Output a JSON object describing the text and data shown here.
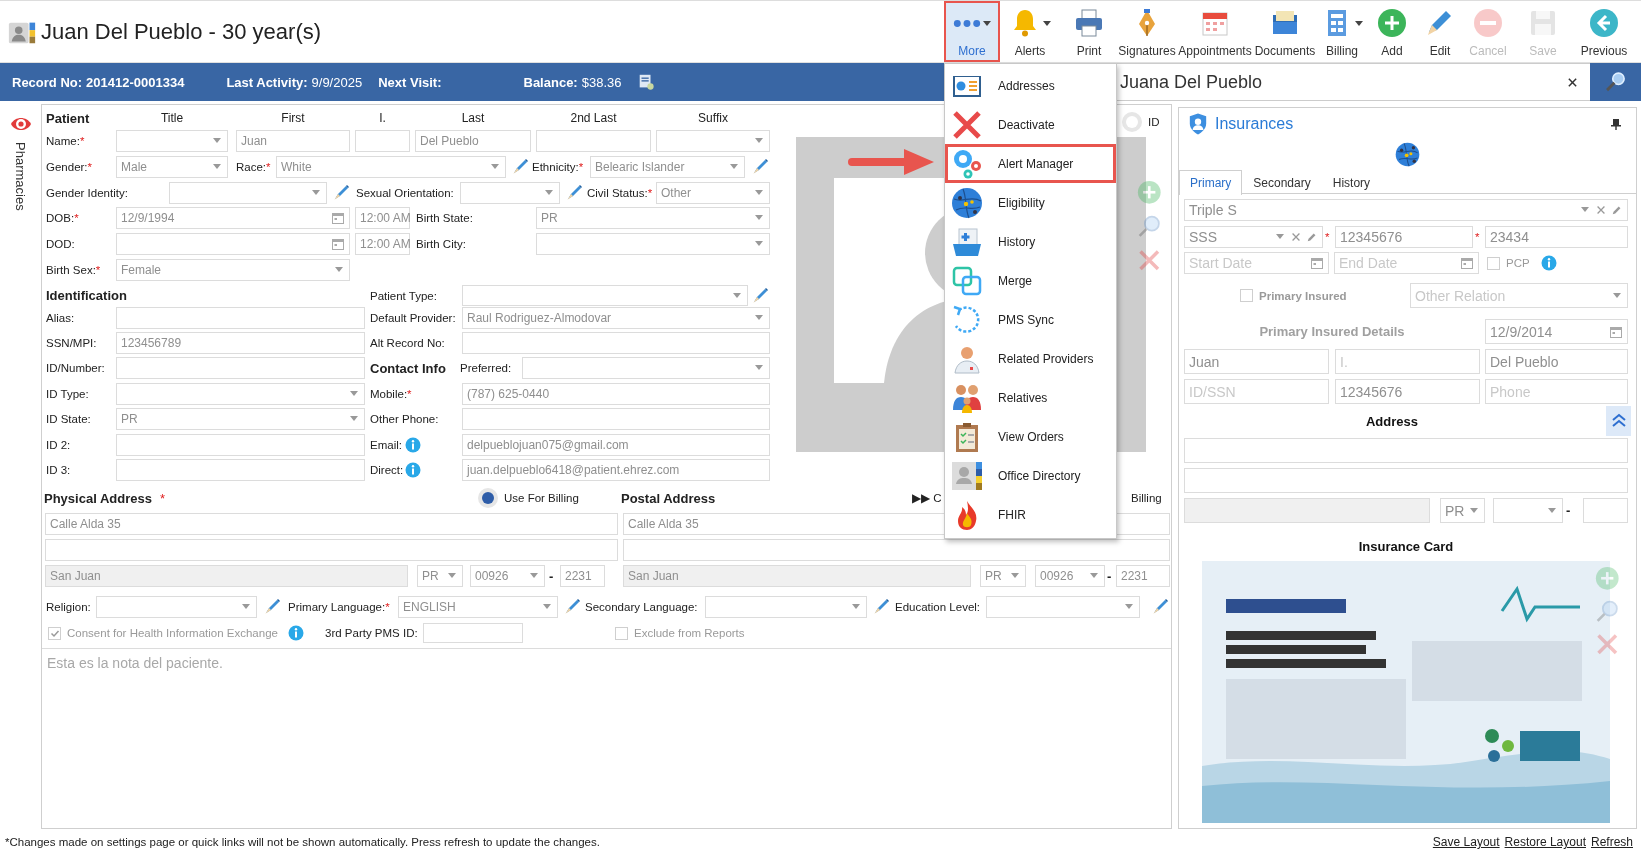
{
  "header": {
    "title": "Juan Del Pueblo - 30 year(s)"
  },
  "toolbar": [
    {
      "kind": "more",
      "label": "More",
      "dropdown": true,
      "disabled": false,
      "annotated": true
    },
    {
      "kind": "alerts",
      "label": "Alerts",
      "dropdown": true,
      "disabled": false,
      "annotated": false
    },
    {
      "kind": "print",
      "label": "Print",
      "dropdown": false,
      "disabled": false,
      "annotated": false
    },
    {
      "kind": "signatures",
      "label": "Signatures",
      "dropdown": false,
      "disabled": false,
      "annotated": false
    },
    {
      "kind": "appointments",
      "label": "Appointments",
      "dropdown": false,
      "disabled": false,
      "annotated": false
    },
    {
      "kind": "documents",
      "label": "Documents",
      "dropdown": false,
      "disabled": false,
      "annotated": false
    },
    {
      "kind": "billing",
      "label": "Billing",
      "dropdown": true,
      "disabled": false,
      "annotated": false
    },
    {
      "kind": "add",
      "label": "Add",
      "dropdown": false,
      "disabled": false,
      "annotated": false
    },
    {
      "kind": "edit",
      "label": "Edit",
      "dropdown": false,
      "disabled": false,
      "annotated": false
    },
    {
      "kind": "cancel",
      "label": "Cancel",
      "dropdown": false,
      "disabled": true,
      "annotated": false
    },
    {
      "kind": "save",
      "label": "Save",
      "dropdown": false,
      "disabled": true,
      "annotated": false
    },
    {
      "kind": "previous",
      "label": "Previous",
      "dropdown": false,
      "disabled": false,
      "annotated": false
    }
  ],
  "info_bar": {
    "items": [
      {
        "label": "Record No:",
        "value": "201412-0001334",
        "strong": true
      },
      {
        "label": "Last Activity:",
        "value": "9/9/2025",
        "strong": false
      },
      {
        "label": "Next Visit:"
      },
      {
        "label": "Balance:",
        "value": "$38.36",
        "strong": false
      }
    ]
  },
  "search": {
    "value": "Juana Del Pueblo"
  },
  "side_tab": {
    "label": "Pharmacies"
  },
  "patient_form": {
    "rows": [
      {
        "items": [
          {
            "kind": "heading",
            "text": "Patient"
          },
          {
            "kind": "caption",
            "text": "Title"
          },
          {
            "kind": "caption",
            "text": "First"
          },
          {
            "kind": "caption",
            "text": "I."
          },
          {
            "kind": "caption",
            "text": "Last"
          },
          {
            "kind": "caption",
            "text": "2nd Last"
          },
          {
            "kind": "caption",
            "text": "Suffix"
          }
        ]
      },
      {
        "items": [
          {
            "kind": "label",
            "text": "Name:",
            "mark": "*"
          },
          {
            "kind": "dropdown"
          },
          {
            "kind": "text",
            "value": "Juan"
          },
          {
            "kind": "text"
          },
          {
            "kind": "text",
            "value": "Del Pueblo"
          },
          {
            "kind": "text"
          },
          {
            "kind": "dropdown"
          }
        ]
      },
      {
        "items": [
          {
            "kind": "label",
            "text": "Gender:",
            "mark": "*"
          },
          {
            "kind": "dropdown",
            "value": "Male"
          },
          {
            "kind": "label",
            "text": "Race:",
            "mark": "*"
          },
          {
            "kind": "dropdown",
            "value": "White"
          },
          {
            "kind": "edit"
          },
          {
            "kind": "label",
            "text": "Ethnicity:",
            "mark": "*"
          },
          {
            "kind": "dropdown",
            "value": "Belearic Islander"
          },
          {
            "kind": "edit"
          }
        ]
      },
      {
        "items": [
          {
            "kind": "label",
            "text": "Gender Identity:"
          },
          {
            "kind": "dropdown"
          },
          {
            "kind": "edit"
          },
          {
            "kind": "label",
            "text": "Sexual Orientation:"
          },
          {
            "kind": "dropdown"
          },
          {
            "kind": "edit"
          },
          {
            "kind": "label",
            "text": "Civil Status:",
            "mark": "*"
          },
          {
            "kind": "dropdown",
            "value": "Other"
          }
        ]
      },
      {
        "items": [
          {
            "kind": "label",
            "text": "DOB:",
            "mark": "*"
          },
          {
            "kind": "date",
            "value": "12/9/1994"
          },
          {
            "kind": "time",
            "value": "12:00 AM"
          },
          {
            "kind": "label",
            "text": "Birth State:"
          },
          {
            "kind": "dropdown",
            "value": "PR"
          }
        ]
      },
      {
        "items": [
          {
            "kind": "label",
            "text": "DOD:"
          },
          {
            "kind": "date"
          },
          {
            "kind": "time",
            "value": "12:00 AM"
          },
          {
            "kind": "label",
            "text": "Birth City:"
          },
          {
            "kind": "dropdown"
          }
        ]
      },
      {
        "items": [
          {
            "kind": "label",
            "text": "Birth Sex:",
            "mark": "*"
          },
          {
            "kind": "dropdown",
            "value": "Female"
          }
        ]
      },
      {
        "items": [
          {
            "kind": "heading",
            "text": "Identification"
          },
          {
            "kind": "label",
            "text": "Patient Type:"
          },
          {
            "kind": "dropdown"
          },
          {
            "kind": "edit"
          }
        ]
      },
      {
        "items": [
          {
            "kind": "label",
            "text": "Alias:"
          },
          {
            "kind": "text"
          },
          {
            "kind": "label",
            "text": "Default Provider:"
          },
          {
            "kind": "dropdown",
            "value": "Raul Rodriguez-Almodovar"
          }
        ]
      },
      {
        "items": [
          {
            "kind": "label",
            "text": "SSN/MPI:"
          },
          {
            "kind": "text",
            "value": "123456789"
          },
          {
            "kind": "label",
            "text": "Alt Record No:"
          },
          {
            "kind": "text"
          }
        ]
      },
      {
        "items": [
          {
            "kind": "label",
            "text": "ID/Number:"
          },
          {
            "kind": "text"
          },
          {
            "kind": "heading",
            "text": "Contact Info"
          },
          {
            "kind": "label",
            "text": "Preferred:"
          },
          {
            "kind": "dropdown"
          }
        ]
      },
      {
        "items": [
          {
            "kind": "label",
            "text": "ID Type:"
          },
          {
            "kind": "dropdown"
          },
          {
            "kind": "label",
            "text": "Mobile:",
            "mark": "*"
          },
          {
            "kind": "text",
            "value": "(787) 625-0440"
          }
        ]
      },
      {
        "items": [
          {
            "kind": "label",
            "text": "ID State:"
          },
          {
            "kind": "dropdown",
            "value": "PR"
          },
          {
            "kind": "label",
            "text": "Other Phone:"
          },
          {
            "kind": "text"
          }
        ]
      },
      {
        "items": [
          {
            "kind": "label",
            "text": "ID 2:"
          },
          {
            "kind": "text"
          },
          {
            "kind": "label",
            "text": "Email:"
          },
          {
            "kind": "info"
          },
          {
            "kind": "text",
            "value": "delpueblojuan075@gmail.com"
          }
        ]
      },
      {
        "items": [
          {
            "kind": "label",
            "text": "ID 3:"
          },
          {
            "kind": "text"
          },
          {
            "kind": "label",
            "text": "Direct:"
          },
          {
            "kind": "info"
          },
          {
            "kind": "text",
            "value": "juan.delpueblo6418@patient.ehrez.com"
          }
        ]
      }
    ],
    "photo_option": {
      "label": "ID",
      "selected": false
    },
    "address_rows": [
      {
        "items": [
          {
            "kind": "heading",
            "text": "Physical Address",
            "mark": "*"
          },
          {
            "kind": "radio",
            "text": "Use For Billing",
            "selected": true
          },
          {
            "kind": "heading",
            "text": "Postal Address"
          },
          {
            "kind": "label",
            "text": "▶▶ C"
          },
          {
            "kind": "label",
            "text": "Billing"
          }
        ]
      },
      {
        "items": [
          {
            "kind": "text",
            "value": "Calle Alda 35"
          },
          {
            "kind": "text",
            "value": "Calle Alda 35"
          }
        ]
      },
      {
        "items": [
          {
            "kind": "text"
          },
          {
            "kind": "text"
          }
        ]
      },
      {
        "items": [
          {
            "kind": "locked_text",
            "value": "San Juan"
          },
          {
            "kind": "dropdown",
            "value": "PR"
          },
          {
            "kind": "dropdown",
            "value": "00926"
          },
          {
            "kind": "dash",
            "text": "-"
          },
          {
            "kind": "text",
            "value": "2231"
          },
          {
            "kind": "locked_text",
            "value": "San Juan"
          },
          {
            "kind": "dropdown",
            "value": "PR"
          },
          {
            "kind": "dropdown",
            "value": "00926"
          },
          {
            "kind": "dash",
            "text": "-"
          },
          {
            "kind": "text",
            "value": "2231"
          }
        ]
      },
      {
        "items": [
          {
            "kind": "label",
            "text": "Religion:"
          },
          {
            "kind": "dropdown"
          },
          {
            "kind": "edit"
          },
          {
            "kind": "label",
            "text": "Primary Language:",
            "mark": "*"
          },
          {
            "kind": "dropdown",
            "value": "ENGLISH"
          },
          {
            "kind": "edit"
          },
          {
            "kind": "label",
            "text": "Secondary Language:"
          },
          {
            "kind": "dropdown"
          },
          {
            "kind": "edit"
          },
          {
            "kind": "label",
            "text": "Education Level:"
          },
          {
            "kind": "dropdown"
          },
          {
            "kind": "edit"
          }
        ]
      },
      {
        "items": [
          {
            "kind": "checkbox",
            "text": "Consent for Health Information Exchange",
            "checked": true,
            "strong": false
          },
          {
            "kind": "info"
          },
          {
            "kind": "label",
            "text": "3rd Party PMS ID:"
          },
          {
            "kind": "text"
          },
          {
            "kind": "checkbox",
            "text": "Exclude from Reports",
            "checked": false,
            "strong": false
          }
        ]
      }
    ],
    "note": {
      "value": "Esta es la nota del paciente."
    }
  },
  "insurances": {
    "title": "Insurances",
    "tabs": [
      {
        "label": "Primary",
        "selected": true
      },
      {
        "label": "Secondary",
        "selected": false
      },
      {
        "label": "History",
        "selected": false
      }
    ],
    "rows": [
      {
        "items": [
          {
            "kind": "combo",
            "value": "Triple S"
          }
        ]
      },
      {
        "items": [
          {
            "kind": "combo",
            "value": "SSS"
          },
          {
            "kind": "mark",
            "text": "*"
          },
          {
            "kind": "text",
            "value": "12345676"
          },
          {
            "kind": "mark",
            "text": "*"
          },
          {
            "kind": "text",
            "value": "23434"
          }
        ]
      },
      {
        "items": [
          {
            "kind": "date",
            "placeholder": "Start Date"
          },
          {
            "kind": "date",
            "placeholder": "End Date"
          },
          {
            "kind": "checkbox",
            "text": "PCP",
            "checked": false,
            "strong": false
          },
          {
            "kind": "info"
          }
        ]
      },
      {
        "items": [
          {
            "kind": "checkbox",
            "text": "Primary Insured",
            "checked": false,
            "strong": true
          },
          {
            "kind": "dropdown",
            "placeholder": "Other Relation"
          }
        ]
      },
      {
        "items": [
          {
            "kind": "muted_title",
            "text": "Primary Insured Details"
          },
          {
            "kind": "date",
            "value": "12/9/2014"
          }
        ]
      },
      {
        "items": [
          {
            "kind": "text",
            "value": "Juan"
          },
          {
            "kind": "text",
            "placeholder": "I."
          },
          {
            "kind": "text",
            "value": "Del Pueblo"
          }
        ]
      },
      {
        "items": [
          {
            "kind": "text",
            "placeholder": "ID/SSN"
          },
          {
            "kind": "text",
            "value": "12345676"
          },
          {
            "kind": "text",
            "placeholder": "Phone"
          }
        ]
      },
      {
        "items": [
          {
            "kind": "section_title",
            "text": "Address"
          },
          {
            "kind": "collapse"
          }
        ]
      },
      {
        "items": [
          {
            "kind": "text"
          }
        ]
      },
      {
        "items": [
          {
            "kind": "text"
          }
        ]
      },
      {
        "items": [
          {
            "kind": "locked_text"
          },
          {
            "kind": "dropdown",
            "value": "PR"
          },
          {
            "kind": "dropdown"
          },
          {
            "kind": "dash",
            "text": "-"
          },
          {
            "kind": "text"
          }
        ]
      },
      {
        "items": [
          {
            "kind": "section_title",
            "text": "Insurance Card"
          }
        ]
      }
    ]
  },
  "more_menu": {
    "items": [
      {
        "kind": "addresses",
        "label": "Addresses",
        "annotated": false
      },
      {
        "kind": "deactivate",
        "label": "Deactivate",
        "annotated": false
      },
      {
        "kind": "alert_manager",
        "label": "Alert Manager",
        "annotated": true
      },
      {
        "kind": "eligibility",
        "label": "Eligibility",
        "annotated": false
      },
      {
        "kind": "history",
        "label": "History",
        "annotated": false
      },
      {
        "kind": "merge",
        "label": "Merge",
        "annotated": false
      },
      {
        "kind": "pms_sync",
        "label": "PMS Sync",
        "annotated": false
      },
      {
        "kind": "related_providers",
        "label": "Related Providers",
        "annotated": false
      },
      {
        "kind": "relatives",
        "label": "Relatives",
        "annotated": false
      },
      {
        "kind": "view_orders",
        "label": "View Orders",
        "annotated": false
      },
      {
        "kind": "office_directory",
        "label": "Office Directory",
        "annotated": false
      },
      {
        "kind": "fhir",
        "label": "FHIR",
        "annotated": false
      }
    ]
  },
  "footer": {
    "note": "*Changes made on settings page or quick links will not be shown automatically. Press refresh to update the changes.",
    "links": [
      "Save Layout",
      "Restore Layout",
      "Refresh"
    ]
  }
}
